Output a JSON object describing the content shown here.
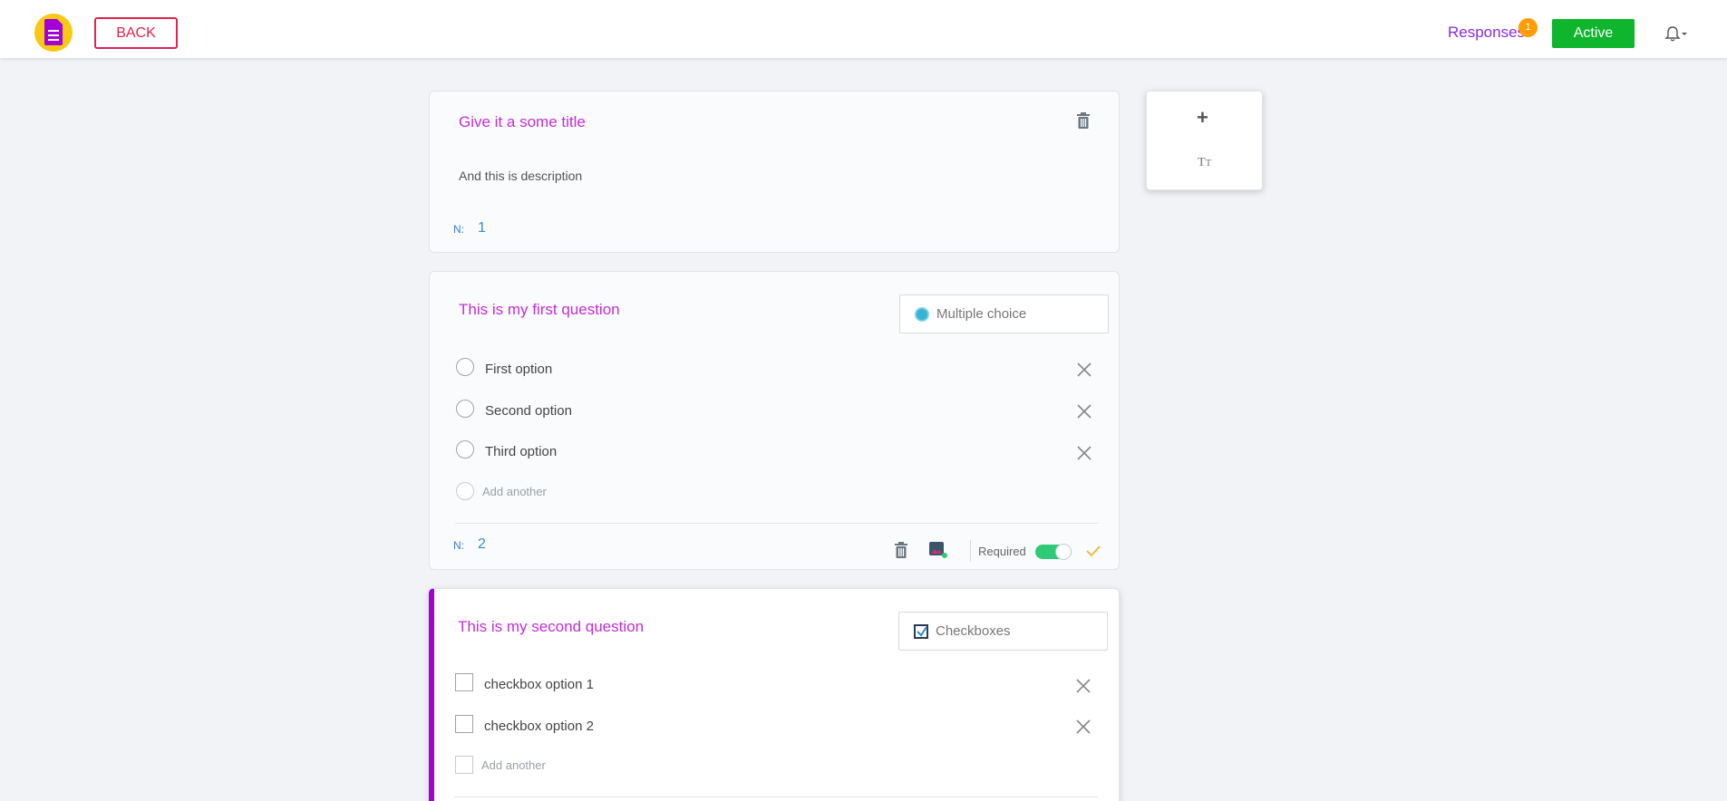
{
  "header": {
    "back_label": "BACK",
    "responses_label": "Responses",
    "responses_count": "1",
    "status_label": "Active",
    "colors": {
      "accent": "#a300d6",
      "back": "#e0224f",
      "active": "#0fb52d",
      "badge": "#ff9d00"
    }
  },
  "title_card": {
    "title": "Give it a some title",
    "description": "And this is description",
    "number_label": "N:",
    "number": "1"
  },
  "questions": [
    {
      "title": "This is my first question",
      "type_label": "Multiple choice",
      "options": [
        "First option",
        "Second option",
        "Third option"
      ],
      "add_placeholder": "Add another",
      "number_label": "N:",
      "number": "2",
      "required_label": "Required",
      "required": true
    },
    {
      "title": "This is my second question",
      "type_label": "Checkboxes",
      "options": [
        "checkbox option 1",
        "checkbox option 2"
      ],
      "add_placeholder": "Add another"
    }
  ],
  "side_toolbar": {
    "icons": [
      "plus-icon",
      "text-format-icon"
    ]
  }
}
